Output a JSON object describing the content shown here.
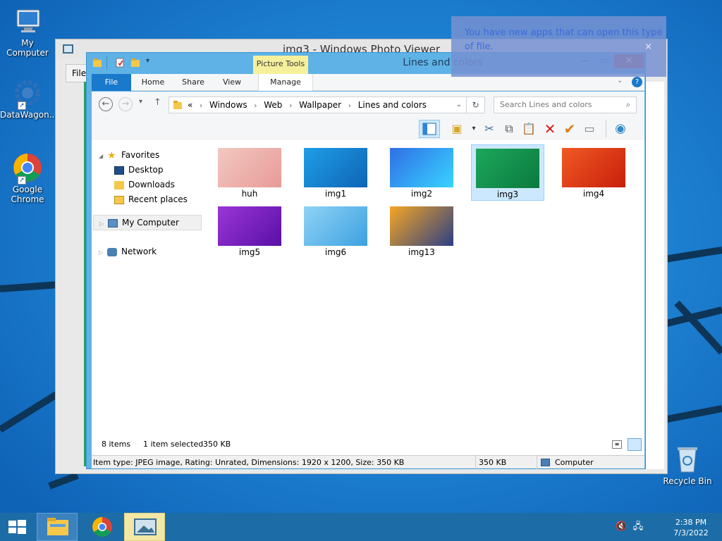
{
  "desktop": {
    "icons": [
      {
        "label": "My Computer",
        "icon": "monitor-icon"
      },
      {
        "label": "DataWagon...",
        "icon": "gear-shortcut-icon"
      },
      {
        "label": "Google Chrome",
        "icon": "chrome-icon"
      },
      {
        "label": "Recycle Bin",
        "icon": "recycle-bin-icon"
      }
    ]
  },
  "photo_viewer": {
    "title": "img3 - Windows Photo Viewer",
    "menu_file": "File"
  },
  "notification": {
    "text": "You have new apps that can open this type of file.",
    "close": "×"
  },
  "explorer": {
    "title": "Lines and colors",
    "contextual_tab": "Picture Tools",
    "tabs": [
      "File",
      "Home",
      "Share",
      "View",
      "Manage"
    ],
    "breadcrumb": [
      "Windows",
      "Web",
      "Wallpaper",
      "Lines and colors"
    ],
    "breadcrumb_prefix": "«",
    "search_placeholder": "Search Lines and colors",
    "nav": {
      "favorites": "Favorites",
      "desktop": "Desktop",
      "downloads": "Downloads",
      "recent": "Recent places",
      "computer": "My Computer",
      "network": "Network"
    },
    "files": [
      {
        "name": "huh",
        "selected": false,
        "colors": [
          "#f2c9c1",
          "#e89a98"
        ]
      },
      {
        "name": "img1",
        "selected": false,
        "colors": [
          "#1e9ee8",
          "#0f64b5"
        ]
      },
      {
        "name": "img2",
        "selected": false,
        "colors": [
          "#2f6fe6",
          "#39d3ff"
        ]
      },
      {
        "name": "img3",
        "selected": true,
        "colors": [
          "#1da75c",
          "#0b7a3e"
        ]
      },
      {
        "name": "img4",
        "selected": false,
        "colors": [
          "#f05a24",
          "#c81e0b"
        ]
      },
      {
        "name": "img5",
        "selected": false,
        "colors": [
          "#9a36d6",
          "#5a0fa6"
        ]
      },
      {
        "name": "img6",
        "selected": false,
        "colors": [
          "#8fd3f6",
          "#3da1e0"
        ]
      },
      {
        "name": "img13",
        "selected": false,
        "colors": [
          "#f5a623",
          "#2b3f85"
        ]
      }
    ],
    "status": {
      "count": "8 items",
      "selection": "1 item selected",
      "size": "350 KB"
    },
    "details": {
      "info": "Item type: JPEG image, Rating: Unrated, Dimensions: 1920 x 1200, Size: 350 KB",
      "size": "350 KB",
      "location": "Computer"
    }
  },
  "taskbar": {
    "time": "2:38 PM",
    "date": "7/3/2022"
  }
}
